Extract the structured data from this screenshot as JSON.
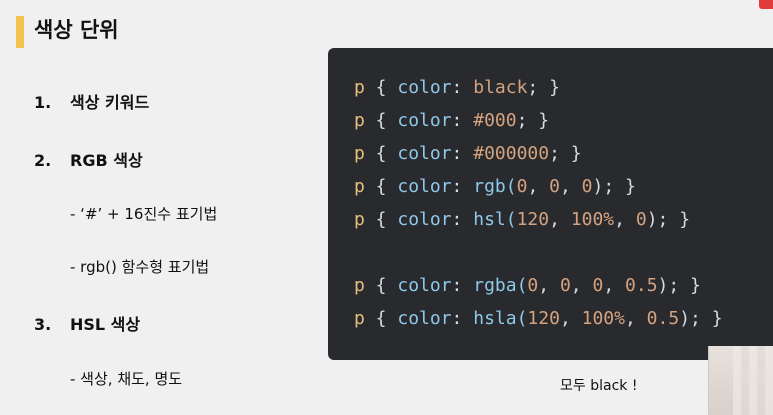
{
  "slide": {
    "title": "색상 단위",
    "outline": [
      {
        "num": "1.",
        "label": "색상 키워드"
      },
      {
        "num": "2.",
        "label": "RGB 색상"
      },
      {
        "label": "- ‘#’ + 16진수 표기법"
      },
      {
        "label": "- rgb() 함수형 표기법"
      },
      {
        "num": "3.",
        "label": "HSL 색상"
      },
      {
        "label": "- 색상, 채도, 명도"
      }
    ],
    "code": [
      [
        {
          "t": "p",
          "c": "sel"
        },
        {
          "t": " { ",
          "c": "punc"
        },
        {
          "t": "color",
          "c": "prop"
        },
        {
          "t": ": ",
          "c": "punc"
        },
        {
          "t": "black",
          "c": "val"
        },
        {
          "t": "; }",
          "c": "punc"
        }
      ],
      [
        {
          "t": "p",
          "c": "sel"
        },
        {
          "t": " { ",
          "c": "punc"
        },
        {
          "t": "color",
          "c": "prop"
        },
        {
          "t": ": ",
          "c": "punc"
        },
        {
          "t": "#000",
          "c": "val"
        },
        {
          "t": "; }",
          "c": "punc"
        }
      ],
      [
        {
          "t": "p",
          "c": "sel"
        },
        {
          "t": " { ",
          "c": "punc"
        },
        {
          "t": "color",
          "c": "prop"
        },
        {
          "t": ": ",
          "c": "punc"
        },
        {
          "t": "#000000",
          "c": "val"
        },
        {
          "t": "; }",
          "c": "punc"
        }
      ],
      [
        {
          "t": "p",
          "c": "sel"
        },
        {
          "t": " { ",
          "c": "punc"
        },
        {
          "t": "color",
          "c": "prop"
        },
        {
          "t": ": ",
          "c": "punc"
        },
        {
          "t": "rgb(",
          "c": "prop"
        },
        {
          "t": "0",
          "c": "num"
        },
        {
          "t": ", ",
          "c": "punc"
        },
        {
          "t": "0",
          "c": "num"
        },
        {
          "t": ", ",
          "c": "punc"
        },
        {
          "t": "0",
          "c": "num"
        },
        {
          "t": "); }",
          "c": "punc"
        }
      ],
      [
        {
          "t": "p",
          "c": "sel"
        },
        {
          "t": " { ",
          "c": "punc"
        },
        {
          "t": "color",
          "c": "prop"
        },
        {
          "t": ": ",
          "c": "punc"
        },
        {
          "t": "hsl(",
          "c": "prop"
        },
        {
          "t": "120",
          "c": "num"
        },
        {
          "t": ", ",
          "c": "punc"
        },
        {
          "t": "100%",
          "c": "num"
        },
        {
          "t": ", ",
          "c": "punc"
        },
        {
          "t": "0",
          "c": "num"
        },
        {
          "t": "); }",
          "c": "punc"
        }
      ],
      [],
      [
        {
          "t": "p",
          "c": "sel"
        },
        {
          "t": " { ",
          "c": "punc"
        },
        {
          "t": "color",
          "c": "prop"
        },
        {
          "t": ": ",
          "c": "punc"
        },
        {
          "t": "rgba(",
          "c": "prop"
        },
        {
          "t": "0",
          "c": "num"
        },
        {
          "t": ", ",
          "c": "punc"
        },
        {
          "t": "0",
          "c": "num"
        },
        {
          "t": ", ",
          "c": "punc"
        },
        {
          "t": "0",
          "c": "num"
        },
        {
          "t": ", ",
          "c": "punc"
        },
        {
          "t": "0.5",
          "c": "num"
        },
        {
          "t": "); }",
          "c": "punc"
        }
      ],
      [
        {
          "t": "p",
          "c": "sel"
        },
        {
          "t": " { ",
          "c": "punc"
        },
        {
          "t": "color",
          "c": "prop"
        },
        {
          "t": ": ",
          "c": "punc"
        },
        {
          "t": "hsla(",
          "c": "prop"
        },
        {
          "t": "120",
          "c": "num"
        },
        {
          "t": ", ",
          "c": "punc"
        },
        {
          "t": "100%",
          "c": "num"
        },
        {
          "t": ", ",
          "c": "punc"
        },
        {
          "t": "0.5",
          "c": "num"
        },
        {
          "t": "); }",
          "c": "punc"
        }
      ]
    ],
    "caption": "모두 black !"
  },
  "colors": {
    "accent": "#f3c34b",
    "background": "#f0f0f0",
    "code_background": "#282a2e",
    "selector": "#e6c07b",
    "property": "#8fc8e8",
    "value": "#d4a27f",
    "punctuation": "#d7dae0",
    "badge": "#e23b3b"
  }
}
